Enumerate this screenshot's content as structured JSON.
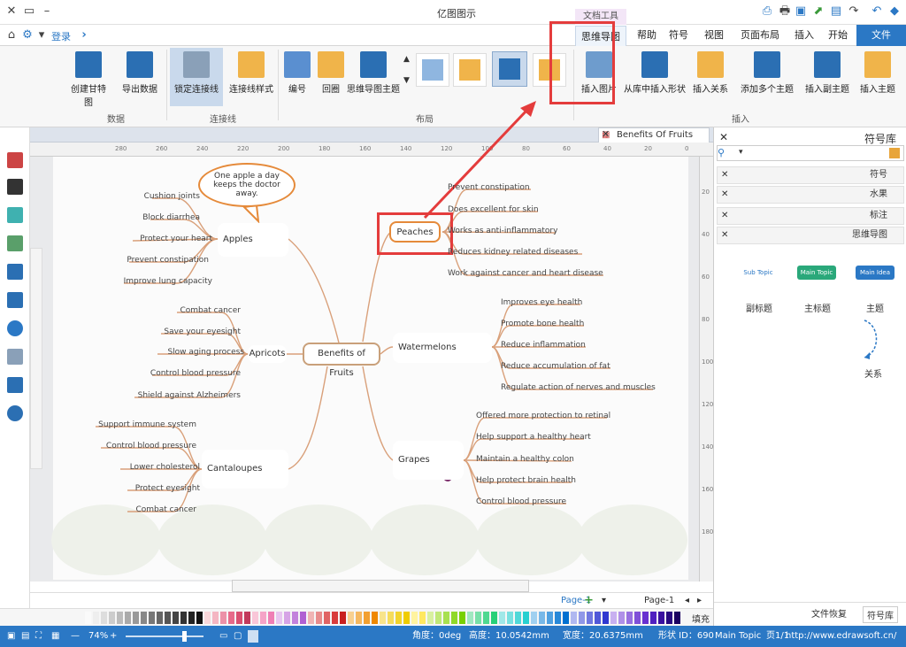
{
  "app": {
    "title": "亿图图示",
    "tool_tab_group": "文档工具"
  },
  "menu": {
    "tabs": [
      "文件",
      "开始",
      "插入",
      "页面布局",
      "视图",
      "符号",
      "帮助",
      "思维导图"
    ],
    "login": "登录"
  },
  "ribbon": {
    "groups": {
      "insert": "插入",
      "layout": "布局",
      "connector": "连接线",
      "data": "数据"
    },
    "buttons": {
      "insert_topic": "插入主题",
      "insert_subtopic": "插入副主题",
      "add_multiple": "添加多个主题",
      "insert_relation": "插入关系",
      "insert_from_library": "从库中插入形状",
      "insert_picture": "插入图片",
      "mindmap_topic": "思维导图主题",
      "numbering": "编号",
      "return": "回圈",
      "connector_style": "连接线样式",
      "lock_connector": "锁定连接线",
      "export_data": "导出数据",
      "create_gantt": "创建甘特图"
    }
  },
  "document": {
    "tab_title": "Benefits Of Fruits"
  },
  "ruler": {
    "h_ticks": [
      "0",
      "20",
      "40",
      "60",
      "80",
      "100",
      "120",
      "140",
      "160",
      "180",
      "200",
      "220",
      "240",
      "260",
      "280"
    ],
    "v_ticks": [
      "20",
      "40",
      "60",
      "80",
      "100",
      "120",
      "140",
      "160",
      "180"
    ]
  },
  "mindmap": {
    "central": "Benefits of Fruits",
    "callout": "One apple a day keeps the doctor away.",
    "branches": [
      {
        "name": "Apples",
        "leaves": [
          "Cushion joints",
          "Block diarrhea",
          "Protect your heart",
          "Prevent constipation",
          "Improve lung capacity"
        ]
      },
      {
        "name": "Apricots",
        "leaves": [
          "Combat cancer",
          "Save your eyesight",
          "Slow aging process",
          "Control blood pressure",
          "Shield against Alzheimers"
        ]
      },
      {
        "name": "Cantaloupes",
        "leaves": [
          "Support immune system",
          "Control blood pressure",
          "Lower cholesterol",
          "Protect eyesight",
          "Combat cancer"
        ]
      },
      {
        "name": "Peaches",
        "leaves": [
          "Prevent constipation",
          "Does excellent for skin",
          "Works as anti-inflammatory",
          "Reduces kidney related diseases",
          "Work against cancer and heart disease"
        ]
      },
      {
        "name": "Watermelons",
        "leaves": [
          "Improves eye health",
          "Promote bone health",
          "Reduce inflammation",
          "Reduce accumulation of fat",
          "Regulate action of nerves and muscles"
        ]
      },
      {
        "name": "Grapes",
        "leaves": [
          "Offered more protection to retinal",
          "Help support a healthy heart",
          "Maintain a healthy colon",
          "Help protect brain health",
          "Control blood pressure"
        ]
      }
    ]
  },
  "pages": {
    "page_menu": "Page-1",
    "page_tab": "Page-1"
  },
  "palette_label": "填充",
  "right_panel": {
    "title": "符号库",
    "libraries": [
      "符号",
      "水果",
      "标注",
      "思维导图"
    ],
    "shapes": [
      {
        "label": "主题",
        "chip": "Main Idea"
      },
      {
        "label": "主标题",
        "chip": "Main Topic"
      },
      {
        "label": "副标题",
        "chip": "Sub Topic"
      },
      {
        "label": "关系"
      }
    ],
    "bottom_tabs": [
      "符号库",
      "文件恢复"
    ]
  },
  "status": {
    "url": "http://www.edrawsoft.cn/",
    "page": "页1/1",
    "shape": "Main Topic",
    "shape_id": "形状 ID：690",
    "width": "宽度：20.6375mm",
    "height": "高度：10.0542mm",
    "angle": "角度：0deg",
    "zoom": "74%"
  },
  "colors": {
    "accent": "#2b78c5",
    "highlight": "#e43c3c",
    "branch_line": "#d9a07a",
    "bubble_border": "#e58a3a"
  }
}
